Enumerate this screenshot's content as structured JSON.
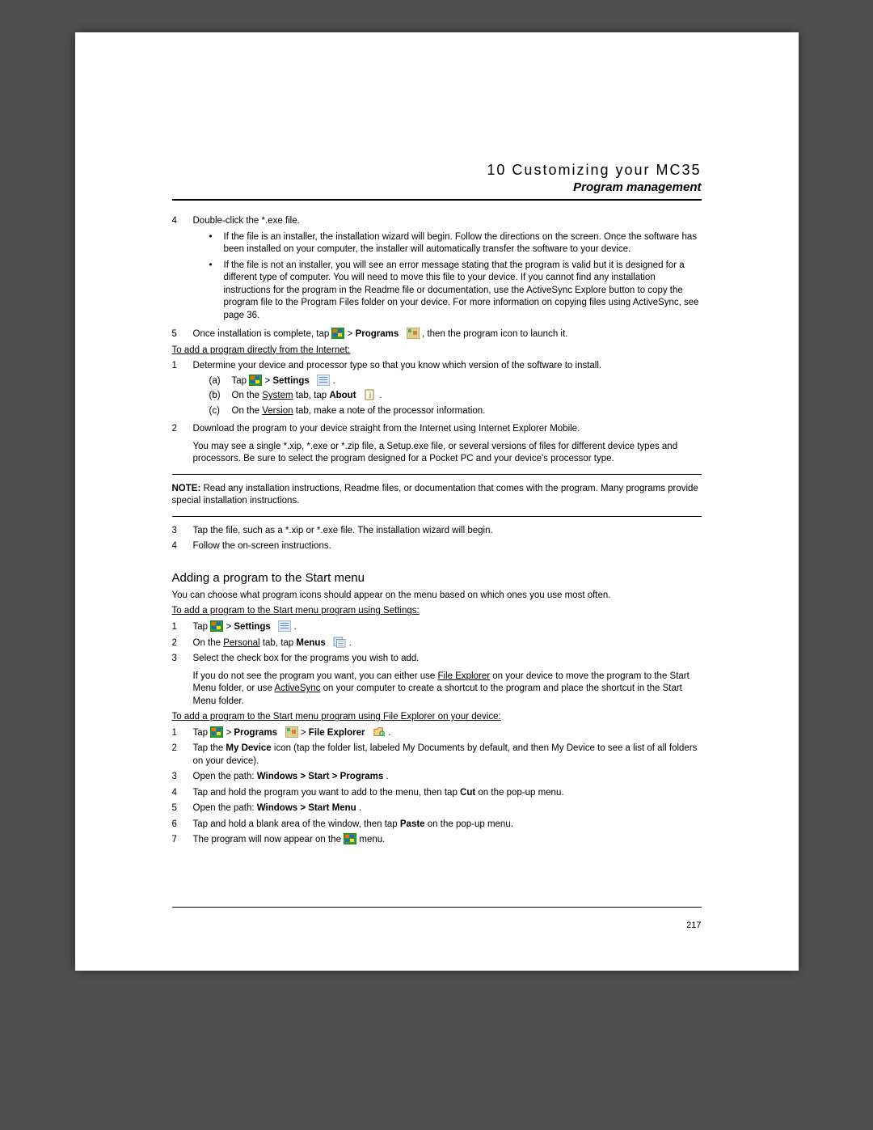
{
  "header": {
    "chapter": "10 Customizing your MC35",
    "section": "Program management"
  },
  "step4": {
    "num": "4",
    "text": "Double-click the *.exe file.",
    "bullets": [
      "If the file is an installer, the installation wizard will begin. Follow the directions on the screen. Once the software has been installed on your computer, the installer will automatically transfer the software to your device.",
      "If the file is not an installer, you will see an error message stating that the program is valid but it is designed for a different type of computer. You will need to move this file to your device. If you cannot find any installation instructions for the program in the Readme file or documentation, use the ActiveSync Explore button to copy the program file to the Program Files folder on your device. For more information on copying files using ActiveSync, see page 36."
    ]
  },
  "step5": {
    "num": "5",
    "pre": "Once installation is complete, tap ",
    "mid": " > ",
    "programs": "Programs",
    "post": ", then the program icon to launch it."
  },
  "internetHeading": "To add a program directly from the Internet:",
  "int1": {
    "num": "1",
    "text": "Determine your device and processor type so that you know which version of the software to install.",
    "a_letter": "(a)",
    "a_pre": "Tap ",
    "a_mid": " > ",
    "a_settings": "Settings",
    "b_letter": "(b)",
    "b_pre": "On the ",
    "b_system": "System",
    "b_mid": " tab, tap ",
    "b_about": "About",
    "c_letter": "(c)",
    "c_pre": "On the ",
    "c_version": "Version",
    "c_post": " tab, make a note of the processor information."
  },
  "int2": {
    "num": "2",
    "text": "Download the program to your device straight from the Internet using Internet Explorer Mobile.",
    "text2": "You may see a single *.xip,  *.exe or *.zip file, a Setup.exe file, or several versions of files for different device types and processors. Be sure to select the program designed for a Pocket PC and your device's processor type."
  },
  "note": {
    "label": "NOTE:",
    "text": "   Read any installation instructions, Readme files, or documentation that comes with the program. Many programs provide special installation instructions."
  },
  "int3": {
    "num": "3",
    "text": "Tap the file, such as a *.xip or *.exe file. The installation wizard will begin."
  },
  "int4": {
    "num": "4",
    "text": "Follow the on-screen instructions."
  },
  "startMenu": {
    "heading": "Adding a program to the Start menu",
    "intro": "You can choose what program icons should appear on the menu based on which ones you use most often.",
    "viaSettingsHeading": "To add a program to the Start menu program using Settings:"
  },
  "sm1": {
    "num": "1",
    "pre": "Tap ",
    "mid": " > ",
    "settings": "Settings"
  },
  "sm2": {
    "num": "2",
    "pre": "On the ",
    "personal": "Personal",
    "mid": " tab, tap ",
    "menus": "Menus"
  },
  "sm3": {
    "num": "3",
    "text": "Select the check box for the programs you wish to add.",
    "text2a": "If you do not see the program you want, you can either use ",
    "fe": "File Explorer",
    "text2b": " on your device to move the program to the Start Menu folder, or use ",
    "as": "ActiveSync",
    "text2c": " on your computer to create a shortcut to the program and place the shortcut in the Start Menu folder."
  },
  "viaFEHeading": "To add a program to the Start menu program using File Explorer on your device:",
  "fe1": {
    "num": "1",
    "pre": "Tap ",
    "mid1": " > ",
    "programs": "Programs",
    "mid2": " > ",
    "fileExplorer": "File Explorer"
  },
  "fe2": {
    "num": "2",
    "pre": "Tap the ",
    "mydevice": "My Device",
    "post": " icon (tap the folder list, labeled My Documents by default, and then My Device to see a list of all folders on your device)."
  },
  "fe3": {
    "num": "3",
    "pre": "Open the path: ",
    "path": "Windows > Start > Programs",
    "post": "."
  },
  "fe4": {
    "num": "4",
    "pre": "Tap and hold the program you want to add to the menu, then tap ",
    "cut": "Cut",
    "post": " on the pop-up menu."
  },
  "fe5": {
    "num": "5",
    "pre": "Open the path: ",
    "path": "Windows > Start Menu",
    "post": "."
  },
  "fe6": {
    "num": "6",
    "pre": "Tap and hold a blank area of the window, then tap ",
    "paste": "Paste",
    "post": " on the pop-up menu."
  },
  "fe7": {
    "num": "7",
    "pre": "The program will now appear on the ",
    "post": " menu."
  },
  "pageNumber": "217"
}
